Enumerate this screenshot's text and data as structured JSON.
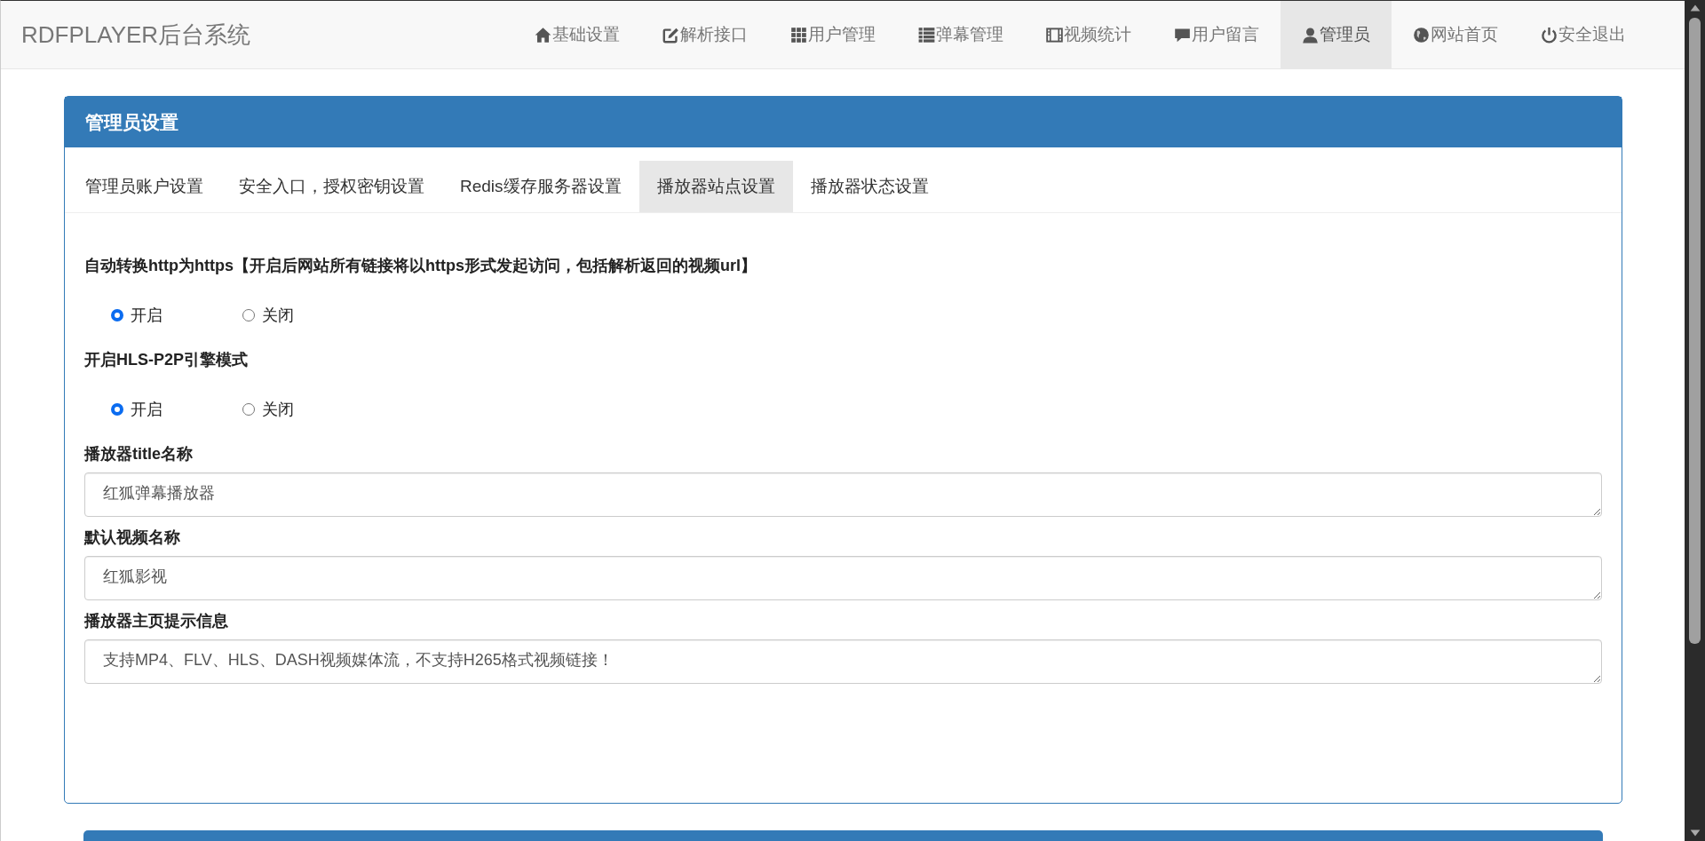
{
  "navbar": {
    "brand": "RDFPLAYER后台系统",
    "items": [
      {
        "label": "基础设置",
        "selected": false
      },
      {
        "label": "解析接口",
        "selected": false
      },
      {
        "label": "用户管理",
        "selected": false
      },
      {
        "label": "弹幕管理",
        "selected": false
      },
      {
        "label": "视频统计",
        "selected": false
      },
      {
        "label": "用户留言",
        "selected": false
      },
      {
        "label": "管理员",
        "selected": true
      },
      {
        "label": "网站首页",
        "selected": false
      },
      {
        "label": "安全退出",
        "selected": false
      }
    ]
  },
  "panel": {
    "title": "管理员设置",
    "tabs": [
      {
        "label": "管理员账户设置",
        "selected": false
      },
      {
        "label": "安全入口，授权密钥设置",
        "selected": false
      },
      {
        "label": "Redis缓存服务器设置",
        "selected": false
      },
      {
        "label": "播放器站点设置",
        "selected": true
      },
      {
        "label": "播放器状态设置",
        "selected": false
      }
    ],
    "fields": [
      {
        "kind": "radio",
        "label": "自动转换http为https【开启后网站所有链接将以https形式发起访问，包括解析返回的视频url】",
        "options": [
          {
            "label": "开启",
            "selected": true
          },
          {
            "label": "关闭",
            "selected": false
          }
        ]
      },
      {
        "kind": "radio",
        "label": "开启HLS-P2P引擎模式",
        "options": [
          {
            "label": "开启",
            "selected": true
          },
          {
            "label": "关闭",
            "selected": false
          }
        ]
      },
      {
        "kind": "textarea",
        "label": "播放器title名称",
        "value": "红狐弹幕播放器"
      },
      {
        "kind": "textarea",
        "label": "默认视频名称",
        "value": "红狐影视"
      },
      {
        "kind": "textarea",
        "label": "播放器主页提示信息",
        "value": "支持MP4、FLV、HLS、DASH视频媒体流，不支持H265格式视频链接！"
      }
    ]
  }
}
